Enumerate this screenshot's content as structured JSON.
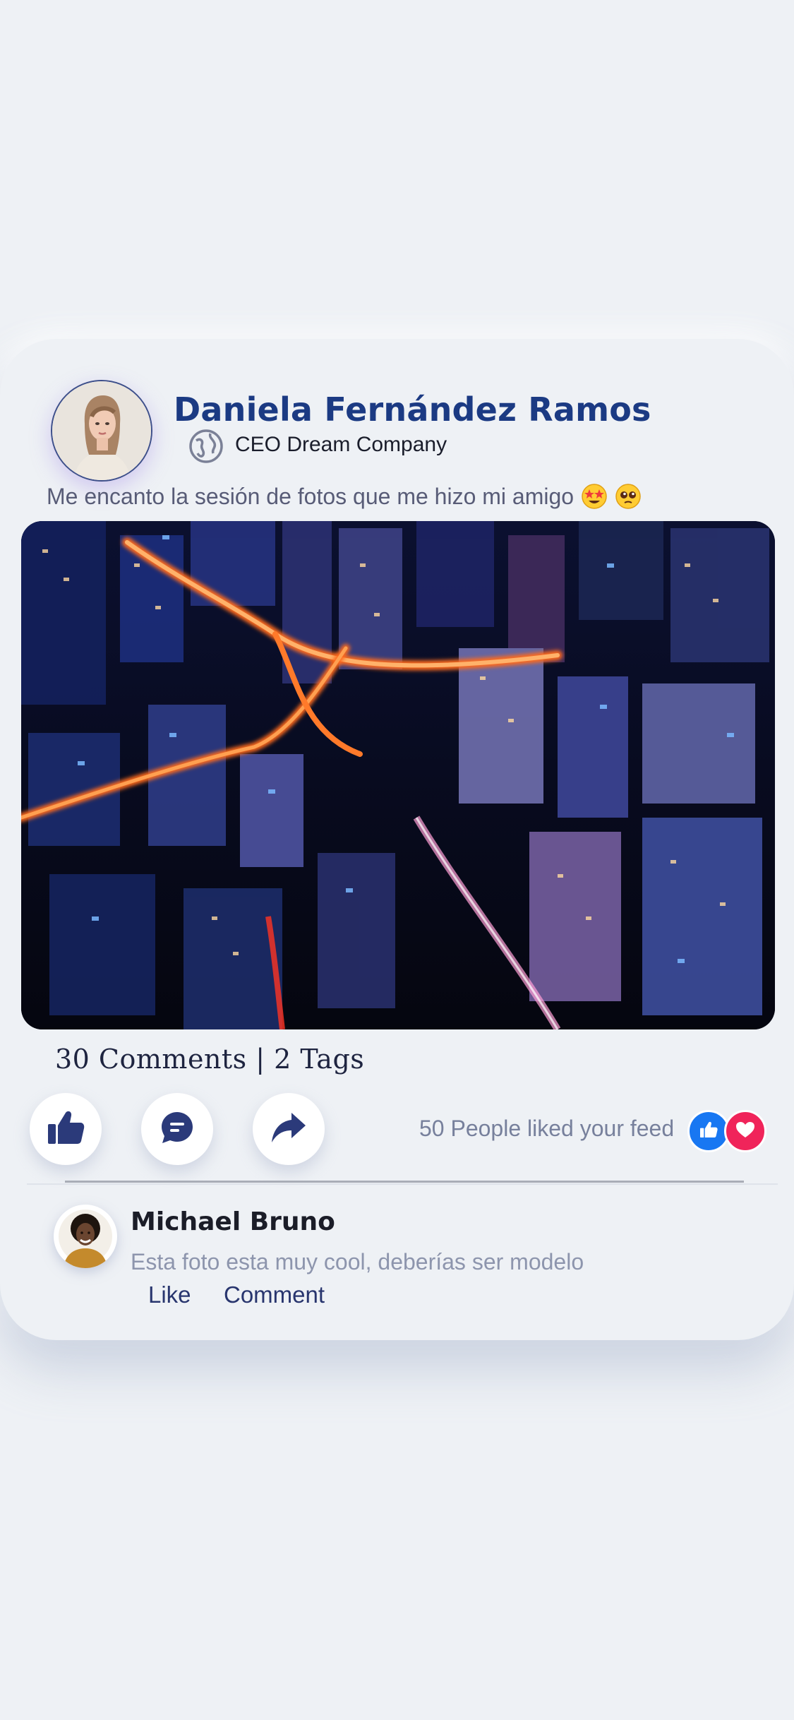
{
  "post": {
    "author_name": "Daniela Fernández Ramos",
    "author_role": "CEO Dream Company",
    "text": "Me encanto la sesión de fotos que me hizo mi amigo",
    "comments_count": "30 Comments",
    "tags_count": "2 Tags",
    "likes_summary": "50 People liked your feed"
  },
  "actions": {
    "like_icon": "thumbs-up-icon",
    "comment_icon": "chat-bubble-icon",
    "share_icon": "share-arrow-icon"
  },
  "comment": {
    "author_name": "Michael Bruno",
    "text": "Esta foto esta muy cool, deberías ser modelo",
    "like_label": "Like",
    "comment_label": "Comment"
  },
  "colors": {
    "brand": "#1b3a83",
    "like_blue": "#1877f2",
    "heart_red": "#f0245a",
    "background": "#eef1f5"
  }
}
